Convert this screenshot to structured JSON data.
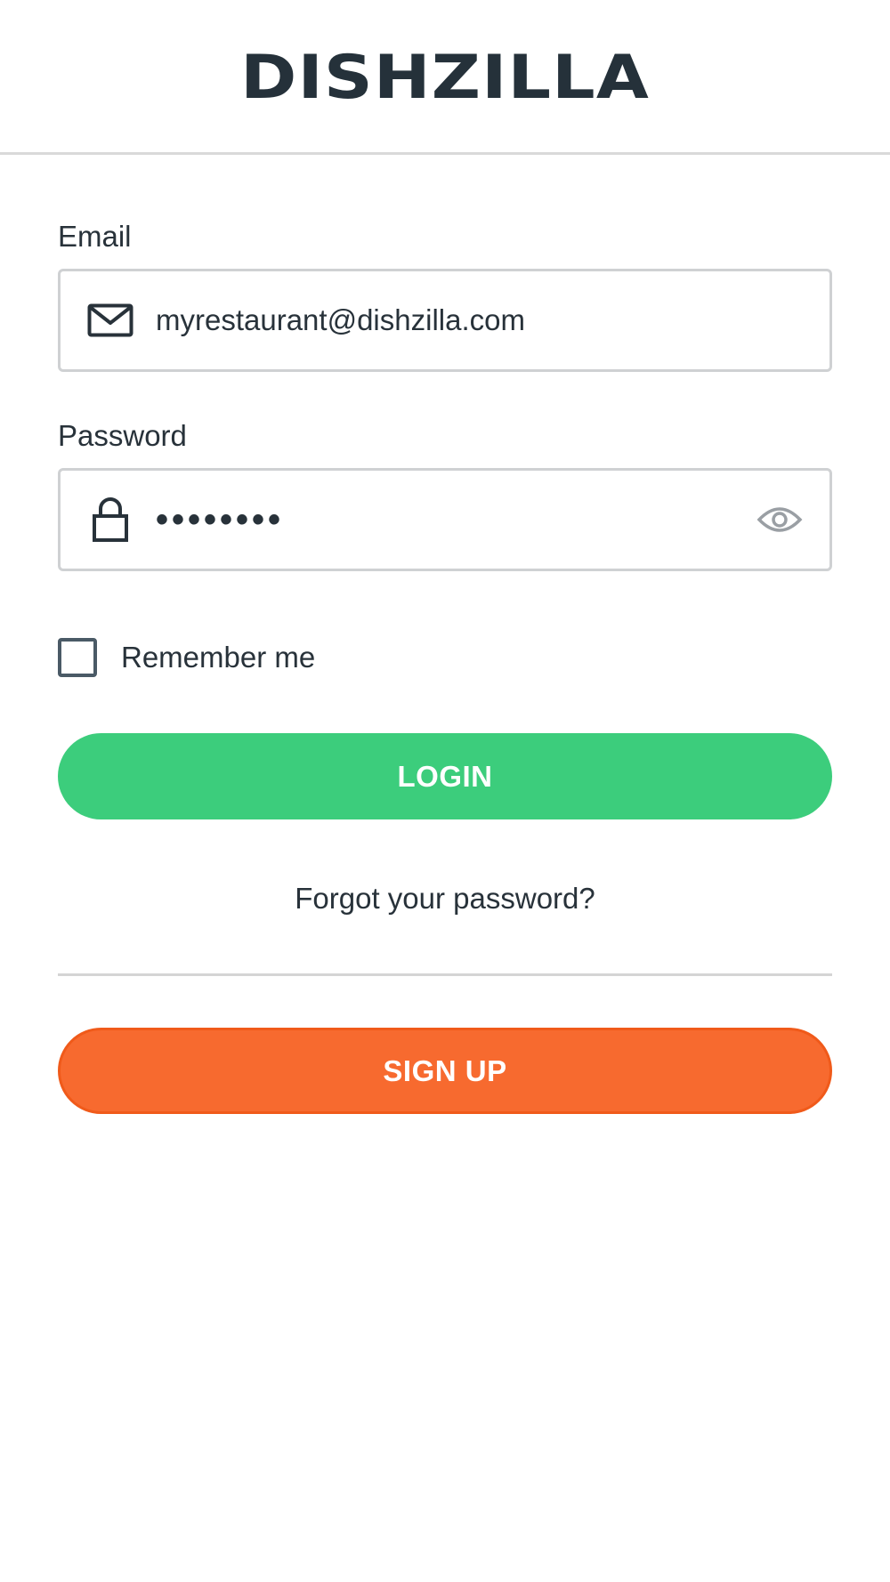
{
  "header": {
    "logo_text": "DISHZILLA"
  },
  "form": {
    "email": {
      "label": "Email",
      "value": "myrestaurant@dishzilla.com",
      "icon": "envelope-icon"
    },
    "password": {
      "label": "Password",
      "value": "••••••••",
      "icon": "lock-icon",
      "toggle_icon": "eye-icon"
    },
    "remember": {
      "label": "Remember me",
      "checked": false
    },
    "login_label": "LOGIN",
    "forgot_label": "Forgot your password?",
    "signup_label": "SIGN UP"
  },
  "colors": {
    "primary_text": "#28323a",
    "login_green": "#3ccd7c",
    "signup_orange": "#f76a2f",
    "border_gray": "#cfd1d3"
  }
}
